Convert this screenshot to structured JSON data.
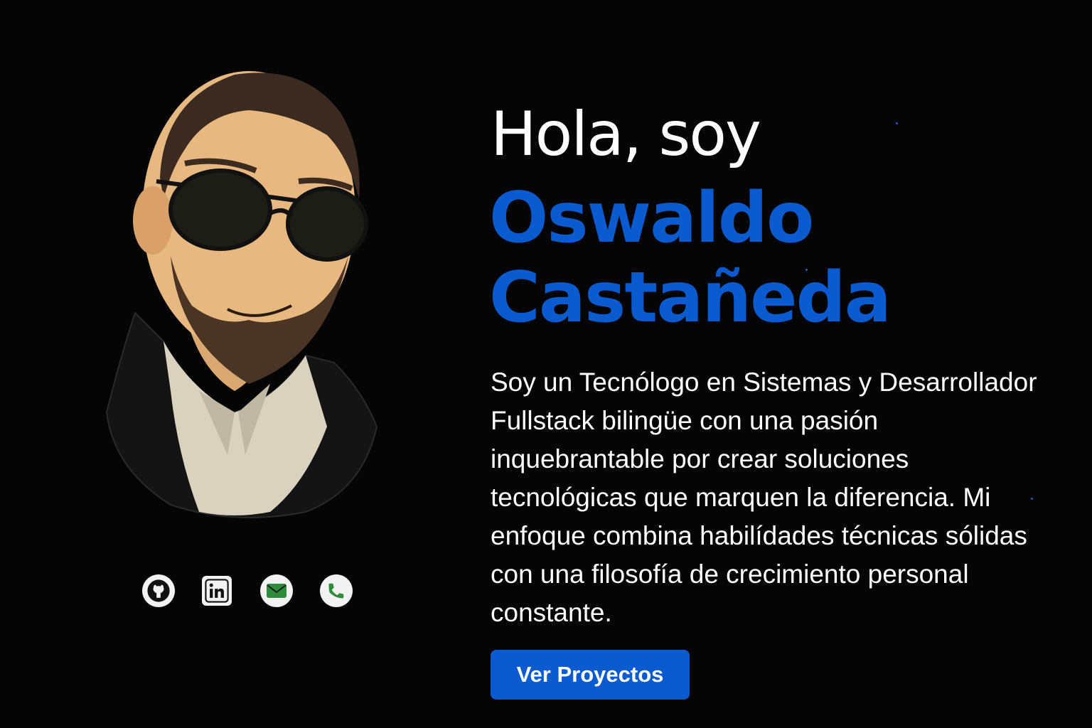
{
  "hero": {
    "greeting": "Hola, soy",
    "name_line1": "Oswaldo",
    "name_line2": "Castañeda",
    "bio": "Soy un Tecnólogo en Sistemas y Desarrollador Fullstack bilingüe con una pasión inquebrantable por crear soluciones tecnológicas que marquen la diferencia. Mi enfoque combina habilídades técnicas sólidas con una filosofía de crecimiento personal constante.",
    "cta_label": "Ver Proyectos"
  },
  "social": [
    {
      "icon": "github-icon"
    },
    {
      "icon": "linkedin-icon"
    },
    {
      "icon": "mail-icon"
    },
    {
      "icon": "phone-icon"
    }
  ],
  "colors": {
    "background": "#050505",
    "accent": "#0a5bd0",
    "text": "#ffffff",
    "icon_bg": "#f2f2f2",
    "phone_icon": "#2e8b3a",
    "mail_icon": "#2e8b3a"
  }
}
